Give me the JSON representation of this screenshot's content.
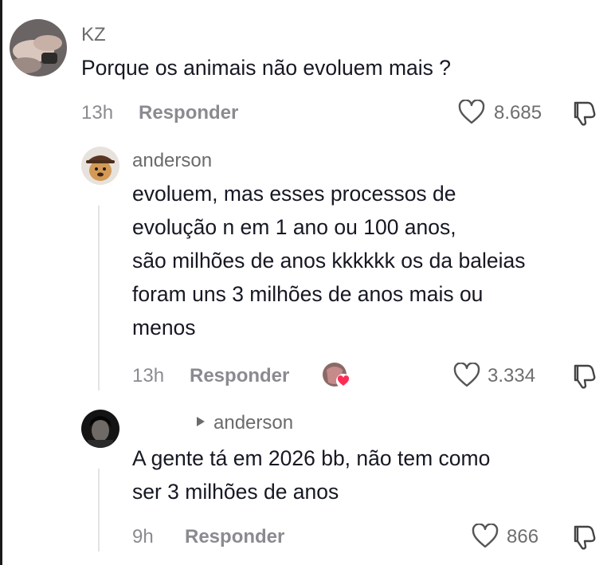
{
  "comments": [
    {
      "username": "KZ",
      "text": [
        "Porque os animais não evoluem mais ?"
      ],
      "time": "13h",
      "reply_label": "Responder",
      "likes": "8.685"
    },
    {
      "username": "anderson",
      "text": [
        "evoluem, mas esses processos de",
        "evolução n em 1 ano ou 100 anos,",
        "são milhões de anos kkkkkk os da baleias",
        "foram uns 3 milhões de anos mais ou",
        "menos"
      ],
      "time": "13h",
      "reply_label": "Responder",
      "likes": "3.334"
    },
    {
      "reply_to": "anderson",
      "text": [
        "A gente tá em 2026 bb, não tem como",
        "ser 3 milhões de anos"
      ],
      "time": "9h",
      "reply_label": "Responder",
      "likes": "866"
    }
  ],
  "icons": {
    "like": "heart-outline-icon",
    "dislike": "thumbs-down-icon",
    "reply_arrow": "triangle-right-icon",
    "creator_liked": "creator-like-badge-icon"
  },
  "colors": {
    "text": "#161823",
    "muted": "#8a8b91",
    "heart_badge": "#fe2c55"
  }
}
